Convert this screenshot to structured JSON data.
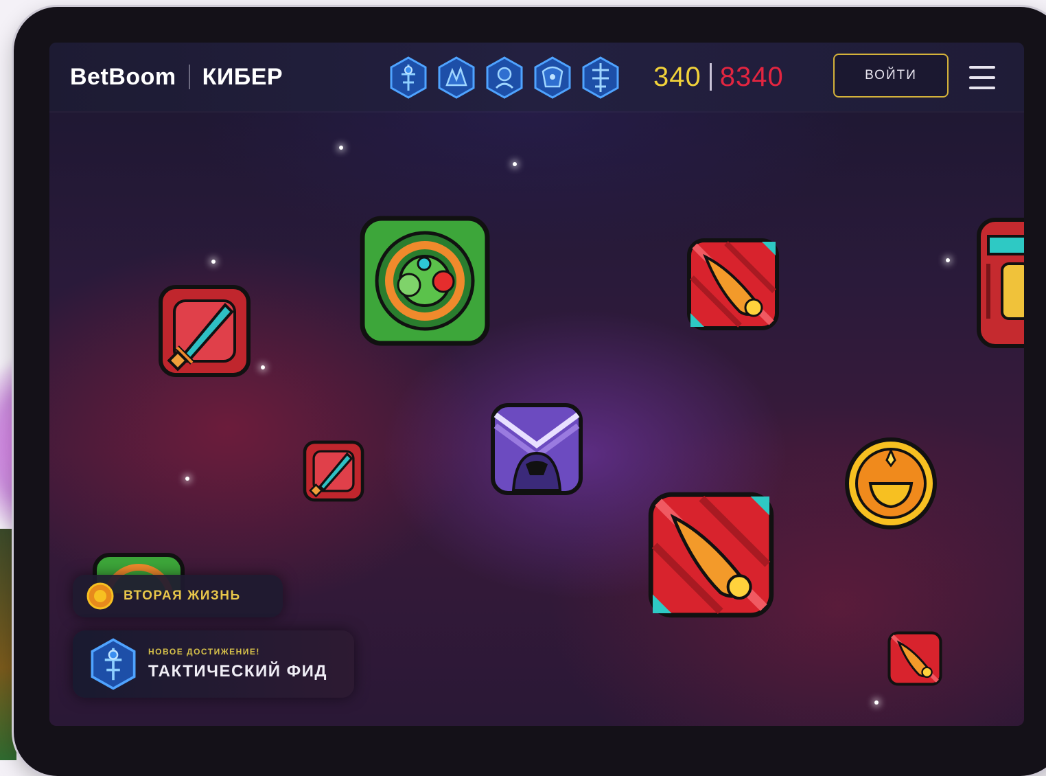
{
  "header": {
    "logo_brand": "BetBoom",
    "logo_product": "КИБЕР",
    "score_primary": "340",
    "score_secondary": "8340",
    "login_label": "ВОЙТИ"
  },
  "hero_icons": [
    "hero-icon-1",
    "hero-icon-2",
    "hero-icon-3",
    "hero-icon-4",
    "hero-icon-5"
  ],
  "toasts": {
    "buff": {
      "label": "ВТОРАЯ ЖИЗНЬ"
    },
    "achievement": {
      "kicker": "НОВОЕ ДОСТИЖЕНИЕ!",
      "title": "ТАКТИЧЕСКИЙ ФИД"
    }
  },
  "colors": {
    "score_primary": "#f1d23a",
    "score_secondary": "#e32540",
    "login_border": "#d4b23a"
  }
}
